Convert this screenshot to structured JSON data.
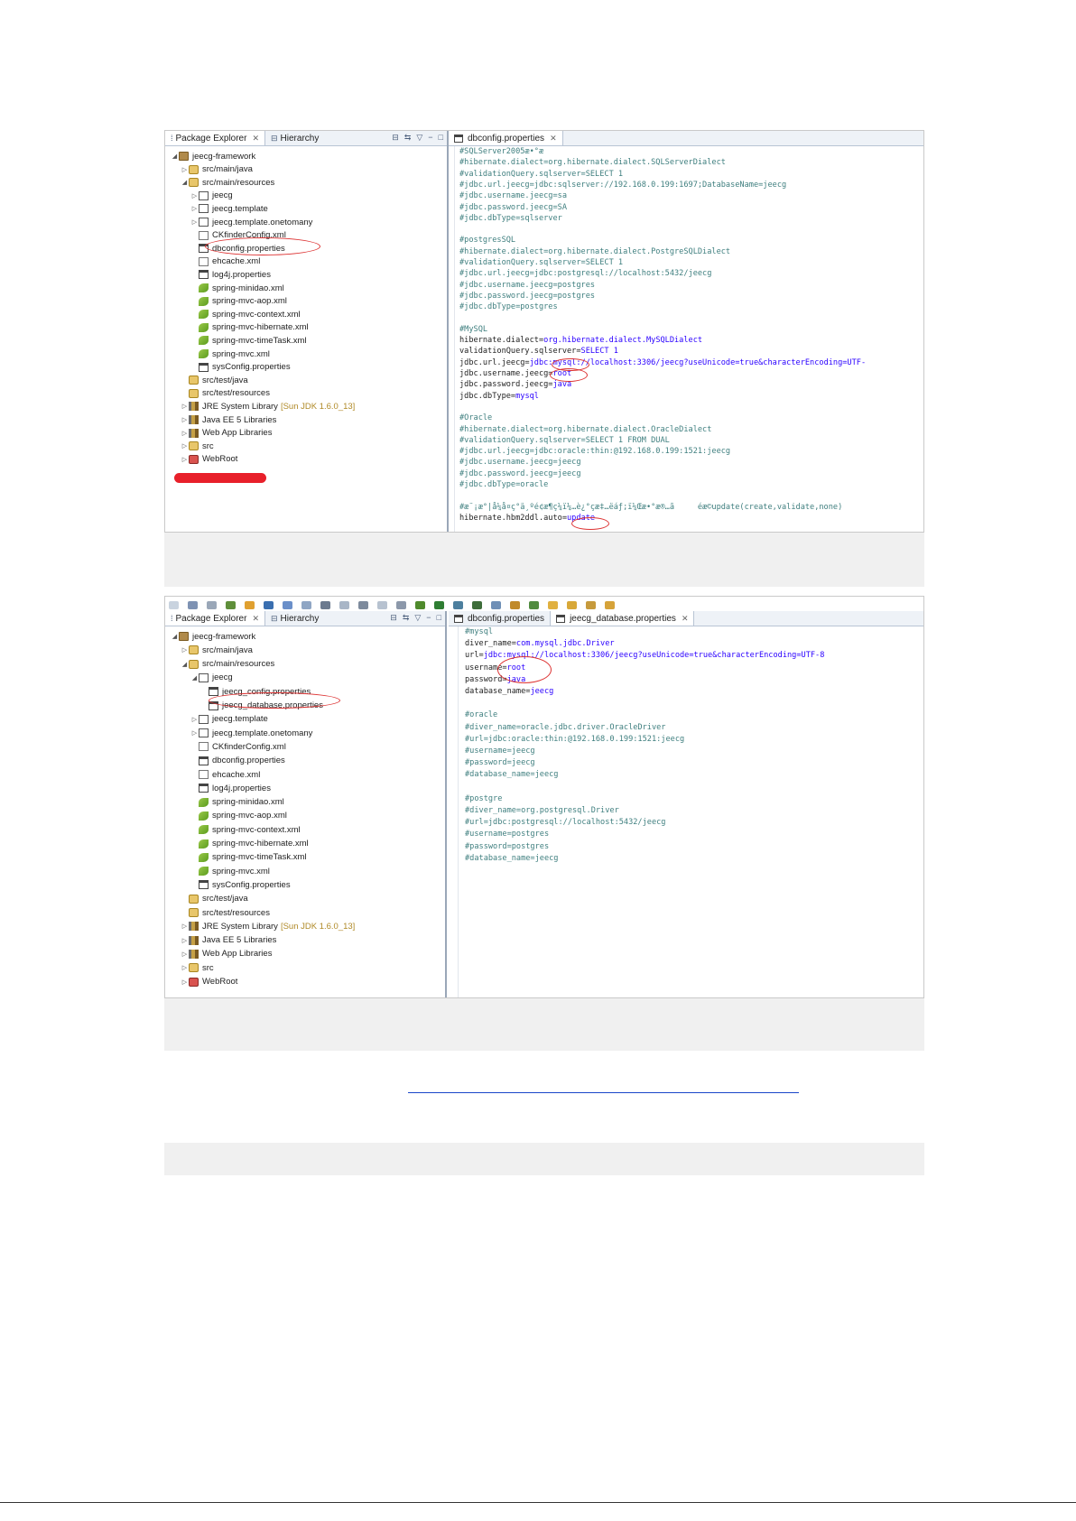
{
  "shot1": {
    "views": {
      "package_explorer": "Package Explorer",
      "hierarchy": "Hierarchy"
    },
    "editor_tab": "dbconfig.properties",
    "tree": [
      {
        "label": "jeecg-framework",
        "icon": "project-icon",
        "expanded": true
      },
      {
        "label": "src/main/java",
        "icon": "source-folder-icon",
        "expanded": false
      },
      {
        "label": "src/main/resources",
        "icon": "source-folder-icon",
        "expanded": true
      },
      {
        "label": "jeecg",
        "icon": "package-icon",
        "expanded": false
      },
      {
        "label": "jeecg.template",
        "icon": "package-icon",
        "expanded": false
      },
      {
        "label": "jeecg.template.onetomany",
        "icon": "package-icon",
        "expanded": false
      },
      {
        "label": "CKfinderConfig.xml",
        "icon": "xml-file-icon"
      },
      {
        "label": "dbconfig.properties",
        "icon": "properties-file-icon"
      },
      {
        "label": "ehcache.xml",
        "icon": "xml-file-icon"
      },
      {
        "label": "log4j.properties",
        "icon": "properties-file-icon"
      },
      {
        "label": "spring-minidao.xml",
        "icon": "spring-file-icon"
      },
      {
        "label": "spring-mvc-aop.xml",
        "icon": "spring-file-icon"
      },
      {
        "label": "spring-mvc-context.xml",
        "icon": "spring-file-icon"
      },
      {
        "label": "spring-mvc-hibernate.xml",
        "icon": "spring-file-icon"
      },
      {
        "label": "spring-mvc-timeTask.xml",
        "icon": "spring-file-icon"
      },
      {
        "label": "spring-mvc.xml",
        "icon": "spring-file-icon"
      },
      {
        "label": "sysConfig.properties",
        "icon": "properties-file-icon"
      },
      {
        "label": "src/test/java",
        "icon": "source-folder-icon"
      },
      {
        "label": "src/test/resources",
        "icon": "source-folder-icon"
      },
      {
        "label": "JRE System Library",
        "note": "[Sun JDK 1.6.0_13]",
        "icon": "library-icon",
        "expanded": false
      },
      {
        "label": "Java EE 5 Libraries",
        "icon": "library-icon",
        "expanded": false
      },
      {
        "label": "Web App Libraries",
        "icon": "library-icon",
        "expanded": false
      },
      {
        "label": "src",
        "icon": "folder-icon",
        "expanded": false
      },
      {
        "label": "WebRoot",
        "icon": "webroot-icon",
        "expanded": false
      }
    ],
    "code": [
      {
        "t": "#SQLServer2005æ•°æ",
        "c": "cm"
      },
      {
        "t": "#hibernate.dialect=org.hibernate.dialect.SQLServerDialect",
        "c": "cm"
      },
      {
        "t": "#validationQuery.sqlserver=SELECT 1",
        "c": "cm"
      },
      {
        "t": "#jdbc.url.jeecg=jdbc:sqlserver://192.168.0.199:1697;DatabaseName=jeecg",
        "c": "cm"
      },
      {
        "t": "#jdbc.username.jeecg=sa",
        "c": "cm"
      },
      {
        "t": "#jdbc.password.jeecg=SA",
        "c": "cm"
      },
      {
        "t": "#jdbc.dbType=sqlserver",
        "c": "cm"
      },
      {
        "t": "",
        "c": "cm"
      },
      {
        "t": "#postgresSQL",
        "c": "cm"
      },
      {
        "t": "#hibernate.dialect=org.hibernate.dialect.PostgreSQLDialect",
        "c": "cm"
      },
      {
        "t": "#validationQuery.sqlserver=SELECT 1",
        "c": "cm"
      },
      {
        "t": "#jdbc.url.jeecg=jdbc:postgresql://localhost:5432/jeecg",
        "c": "cm"
      },
      {
        "t": "#jdbc.username.jeecg=postgres",
        "c": "cm"
      },
      {
        "t": "#jdbc.password.jeecg=postgres",
        "c": "cm"
      },
      {
        "t": "#jdbc.dbType=postgres",
        "c": "cm"
      },
      {
        "t": "",
        "c": "cm"
      },
      {
        "t": "#MySQL",
        "c": "cm"
      },
      {
        "k": "hibernate.dialect=",
        "v": "org.hibernate.dialect.MySQLDialect"
      },
      {
        "k": "validationQuery.sqlserver=",
        "v": "SELECT 1"
      },
      {
        "k": "jdbc.url.jeecg=",
        "v": "jdbc:mysql://localhost:3306/jeecg?useUnicode=true&characterEncoding=UTF-"
      },
      {
        "k": "jdbc.username.jeecg=",
        "v": "root"
      },
      {
        "k": "jdbc.password.jeecg=",
        "v": "java"
      },
      {
        "k": "jdbc.dbType=",
        "v": "mysql"
      },
      {
        "t": "",
        "c": "cm"
      },
      {
        "t": "#Oracle",
        "c": "cm"
      },
      {
        "t": "#hibernate.dialect=org.hibernate.dialect.OracleDialect",
        "c": "cm"
      },
      {
        "t": "#validationQuery.sqlserver=SELECT 1 FROM DUAL",
        "c": "cm"
      },
      {
        "t": "#jdbc.url.jeecg=jdbc:oracle:thin:@192.168.0.199:1521:jeecg",
        "c": "cm"
      },
      {
        "t": "#jdbc.username.jeecg=jeecg",
        "c": "cm"
      },
      {
        "t": "#jdbc.password.jeecg=jeecg",
        "c": "cm"
      },
      {
        "t": "#jdbc.dbType=oracle",
        "c": "cm"
      },
      {
        "t": "",
        "c": "cm"
      },
      {
        "t": "#æ¨¡æ°|å¼å¤ç°ä¸ºé¢æ¶ç¼ï¼…è¿°çæ‡…ëáƒ;ï¼Œæ•°æ®…ã     éæ©update(create,validate,none)",
        "c": "cm"
      },
      {
        "k": "hibernate.hbm2ddl.auto=",
        "v": "update"
      }
    ]
  },
  "shot2": {
    "views": {
      "package_explorer": "Package Explorer",
      "hierarchy": "Hierarchy"
    },
    "editor_tabs": [
      "dbconfig.properties",
      "jeecg_database.properties"
    ],
    "tree": [
      {
        "label": "jeecg-framework",
        "icon": "project-icon",
        "expanded": true
      },
      {
        "label": "src/main/java",
        "icon": "source-folder-icon",
        "expanded": false
      },
      {
        "label": "src/main/resources",
        "icon": "source-folder-icon",
        "expanded": true
      },
      {
        "label": "jeecg",
        "icon": "package-icon",
        "expanded": true
      },
      {
        "label": "jeecg_config.properties",
        "icon": "properties-file-icon"
      },
      {
        "label": "jeecg_database.properties",
        "icon": "properties-file-icon"
      },
      {
        "label": "jeecg.template",
        "icon": "package-icon",
        "expanded": false
      },
      {
        "label": "jeecg.template.onetomany",
        "icon": "package-icon",
        "expanded": false
      },
      {
        "label": "CKfinderConfig.xml",
        "icon": "xml-file-icon"
      },
      {
        "label": "dbconfig.properties",
        "icon": "properties-file-icon"
      },
      {
        "label": "ehcache.xml",
        "icon": "xml-file-icon"
      },
      {
        "label": "log4j.properties",
        "icon": "properties-file-icon"
      },
      {
        "label": "spring-minidao.xml",
        "icon": "spring-file-icon"
      },
      {
        "label": "spring-mvc-aop.xml",
        "icon": "spring-file-icon"
      },
      {
        "label": "spring-mvc-context.xml",
        "icon": "spring-file-icon"
      },
      {
        "label": "spring-mvc-hibernate.xml",
        "icon": "spring-file-icon"
      },
      {
        "label": "spring-mvc-timeTask.xml",
        "icon": "spring-file-icon"
      },
      {
        "label": "spring-mvc.xml",
        "icon": "spring-file-icon"
      },
      {
        "label": "sysConfig.properties",
        "icon": "properties-file-icon"
      },
      {
        "label": "src/test/java",
        "icon": "source-folder-icon"
      },
      {
        "label": "src/test/resources",
        "icon": "source-folder-icon"
      },
      {
        "label": "JRE System Library",
        "note": "[Sun JDK 1.6.0_13]",
        "icon": "library-icon",
        "expanded": false
      },
      {
        "label": "Java EE 5 Libraries",
        "icon": "library-icon",
        "expanded": false
      },
      {
        "label": "Web App Libraries",
        "icon": "library-icon",
        "expanded": false
      },
      {
        "label": "src",
        "icon": "folder-icon",
        "expanded": false
      },
      {
        "label": "WebRoot",
        "icon": "webroot-icon",
        "expanded": false
      }
    ],
    "code": [
      {
        "t": "#mysql",
        "c": "cm"
      },
      {
        "k": "diver_name=",
        "v": "com.mysql.jdbc.Driver"
      },
      {
        "k": "url=",
        "v": "jdbc:mysql://localhost:3306/jeecg?useUnicode=true&characterEncoding=UTF-8"
      },
      {
        "k": "username=",
        "v": "root"
      },
      {
        "k": "password=",
        "v": "java"
      },
      {
        "k": "database_name=",
        "v": "jeecg"
      },
      {
        "t": "",
        "c": "cm"
      },
      {
        "t": "#oracle",
        "c": "cm"
      },
      {
        "t": "#diver_name=oracle.jdbc.driver.OracleDriver",
        "c": "cm"
      },
      {
        "t": "#url=jdbc:oracle:thin:@192.168.0.199:1521:jeecg",
        "c": "cm"
      },
      {
        "t": "#username=jeecg",
        "c": "cm"
      },
      {
        "t": "#password=jeecg",
        "c": "cm"
      },
      {
        "t": "#database_name=jeecg",
        "c": "cm"
      },
      {
        "t": "",
        "c": "cm"
      },
      {
        "t": "#postgre",
        "c": "cm"
      },
      {
        "t": "#diver_name=org.postgresql.Driver",
        "c": "cm"
      },
      {
        "t": "#url=jdbc:postgresql://localhost:5432/jeecg",
        "c": "cm"
      },
      {
        "t": "#username=postgres",
        "c": "cm"
      },
      {
        "t": "#password=postgres",
        "c": "cm"
      },
      {
        "t": "#database_name=jeecg",
        "c": "cm"
      }
    ]
  },
  "colors": {
    "comment": "#3f7f7f",
    "value": "#2a00ff",
    "annotation": "#d33333",
    "redaction": "#e8202a",
    "link": "#1a47c9"
  }
}
